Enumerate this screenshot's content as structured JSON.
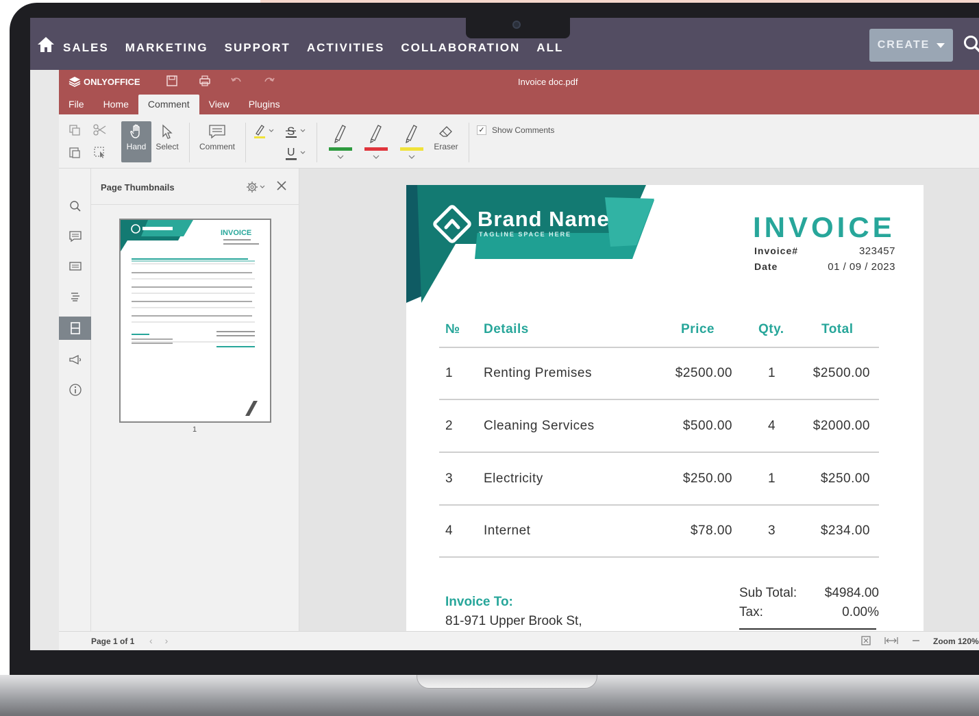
{
  "crm": {
    "nav": [
      "SALES",
      "MARKETING",
      "SUPPORT",
      "ACTIVITIES",
      "COLLABORATION",
      "ALL"
    ],
    "create_label": "CREATE"
  },
  "editor": {
    "logo": "ONLYOFFICE",
    "document_title": "Invoice doc.pdf",
    "tabs": [
      "File",
      "Home",
      "Comment",
      "View",
      "Plugins"
    ],
    "active_tab": "Comment",
    "toolbar": {
      "hand": "Hand",
      "select": "Select",
      "comment": "Comment",
      "eraser": "Eraser",
      "show_comments": "Show Comments",
      "pen_colors": [
        "#2e9a3f",
        "#e0353c",
        "#f0e23a"
      ]
    },
    "thumbnails": {
      "title": "Page Thumbnails",
      "page_number": "1"
    },
    "status": {
      "page": "Page 1 of 1",
      "zoom": "Zoom 120%"
    }
  },
  "invoice": {
    "brand_name": "Brand Name",
    "tagline": "TAGLINE SPACE HERE",
    "title": "INVOICE",
    "invoice_no_label": "Invoice#",
    "invoice_no": "323457",
    "date_label": "Date",
    "date": "01 / 09 / 2023",
    "headers": {
      "no": "№",
      "details": "Details",
      "price": "Price",
      "qty": "Qty.",
      "total": "Total"
    },
    "rows": [
      {
        "no": "1",
        "details": "Renting Premises",
        "price": "$2500.00",
        "qty": "1",
        "total": "$2500.00"
      },
      {
        "no": "2",
        "details": "Cleaning Services",
        "price": "$500.00",
        "qty": "4",
        "total": "$2000.00"
      },
      {
        "no": "3",
        "details": "Electricity",
        "price": "$250.00",
        "qty": "1",
        "total": "$250.00"
      },
      {
        "no": "4",
        "details": "Internet",
        "price": "$78.00",
        "qty": "3",
        "total": "$234.00"
      }
    ],
    "invoice_to_label": "Invoice To:",
    "address_line1": "81-971 Upper Brook St,",
    "subtotal_label": "Sub Total:",
    "subtotal": "$4984.00",
    "tax_label": "Tax:",
    "tax": "0.00%",
    "accent_color": "#27a69a"
  }
}
